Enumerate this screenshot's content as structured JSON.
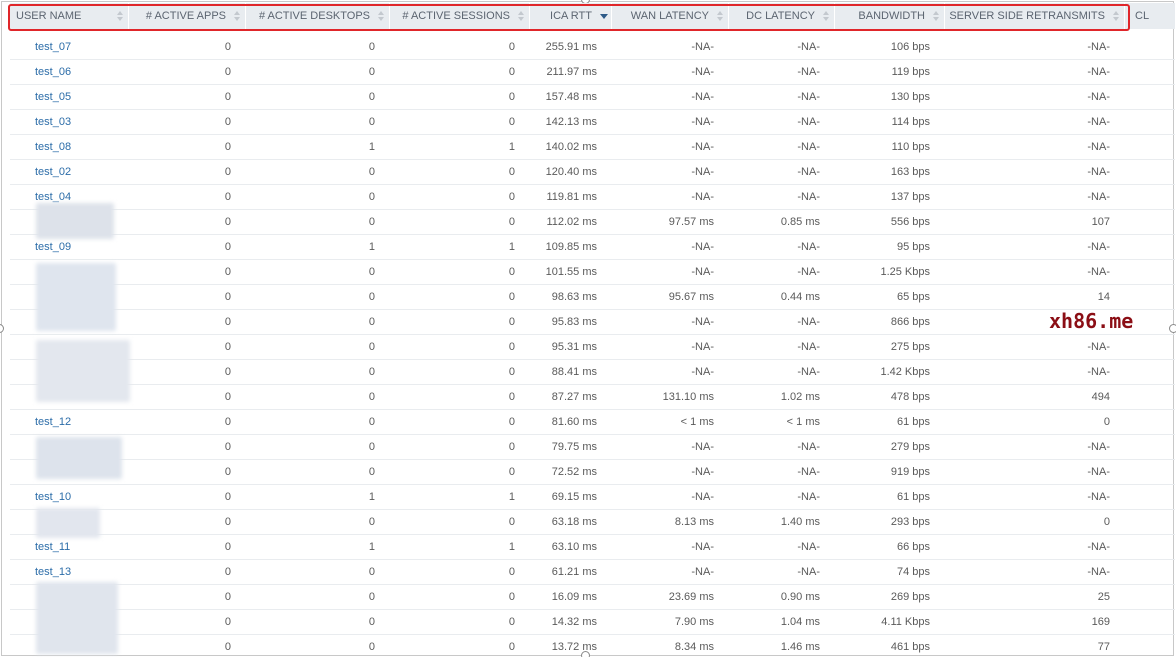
{
  "table": {
    "columns": [
      {
        "label": "USER NAME",
        "sort": "none"
      },
      {
        "label": "# ACTIVE APPS",
        "sort": "none"
      },
      {
        "label": "# ACTIVE DESKTOPS",
        "sort": "none"
      },
      {
        "label": "# ACTIVE SESSIONS",
        "sort": "none"
      },
      {
        "label": "ICA RTT",
        "sort": "descending"
      },
      {
        "label": "WAN LATENCY",
        "sort": "none"
      },
      {
        "label": "DC LATENCY",
        "sort": "none"
      },
      {
        "label": "BANDWIDTH",
        "sort": "none"
      },
      {
        "label": "SERVER SIDE RETRANSMITS",
        "sort": "none"
      },
      {
        "label": "CL",
        "sort": "none"
      }
    ],
    "rows": [
      {
        "user": "test_07",
        "apps": "0",
        "desktops": "0",
        "sessions": "0",
        "ica_rtt": "255.91 ms",
        "wan": "-NA-",
        "dc": "-NA-",
        "bandwidth": "106 bps",
        "retrans": "-NA-"
      },
      {
        "user": "test_06",
        "apps": "0",
        "desktops": "0",
        "sessions": "0",
        "ica_rtt": "211.97 ms",
        "wan": "-NA-",
        "dc": "-NA-",
        "bandwidth": "119 bps",
        "retrans": "-NA-"
      },
      {
        "user": "test_05",
        "apps": "0",
        "desktops": "0",
        "sessions": "0",
        "ica_rtt": "157.48 ms",
        "wan": "-NA-",
        "dc": "-NA-",
        "bandwidth": "130 bps",
        "retrans": "-NA-"
      },
      {
        "user": "test_03",
        "apps": "0",
        "desktops": "0",
        "sessions": "0",
        "ica_rtt": "142.13 ms",
        "wan": "-NA-",
        "dc": "-NA-",
        "bandwidth": "114 bps",
        "retrans": "-NA-"
      },
      {
        "user": "test_08",
        "apps": "0",
        "desktops": "1",
        "sessions": "1",
        "ica_rtt": "140.02 ms",
        "wan": "-NA-",
        "dc": "-NA-",
        "bandwidth": "110 bps",
        "retrans": "-NA-"
      },
      {
        "user": "test_02",
        "apps": "0",
        "desktops": "0",
        "sessions": "0",
        "ica_rtt": "120.40 ms",
        "wan": "-NA-",
        "dc": "-NA-",
        "bandwidth": "163 bps",
        "retrans": "-NA-"
      },
      {
        "user": "test_04",
        "apps": "0",
        "desktops": "0",
        "sessions": "0",
        "ica_rtt": "119.81 ms",
        "wan": "-NA-",
        "dc": "-NA-",
        "bandwidth": "137 bps",
        "retrans": "-NA-"
      },
      {
        "user": "",
        "apps": "0",
        "desktops": "0",
        "sessions": "0",
        "ica_rtt": "112.02 ms",
        "wan": "97.57 ms",
        "dc": "0.85 ms",
        "bandwidth": "556 bps",
        "retrans": "107"
      },
      {
        "user": "test_09",
        "apps": "0",
        "desktops": "1",
        "sessions": "1",
        "ica_rtt": "109.85 ms",
        "wan": "-NA-",
        "dc": "-NA-",
        "bandwidth": "95 bps",
        "retrans": "-NA-"
      },
      {
        "user": "",
        "apps": "0",
        "desktops": "0",
        "sessions": "0",
        "ica_rtt": "101.55 ms",
        "wan": "-NA-",
        "dc": "-NA-",
        "bandwidth": "1.25 Kbps",
        "retrans": "-NA-"
      },
      {
        "user": "",
        "apps": "0",
        "desktops": "0",
        "sessions": "0",
        "ica_rtt": "98.63 ms",
        "wan": "95.67 ms",
        "dc": "0.44 ms",
        "bandwidth": "65 bps",
        "retrans": "14"
      },
      {
        "user": "",
        "apps": "0",
        "desktops": "0",
        "sessions": "0",
        "ica_rtt": "95.83 ms",
        "wan": "-NA-",
        "dc": "-NA-",
        "bandwidth": "866 bps",
        "retrans": ""
      },
      {
        "user": "",
        "apps": "0",
        "desktops": "0",
        "sessions": "0",
        "ica_rtt": "95.31 ms",
        "wan": "-NA-",
        "dc": "-NA-",
        "bandwidth": "275 bps",
        "retrans": "-NA-"
      },
      {
        "user": "",
        "apps": "0",
        "desktops": "0",
        "sessions": "0",
        "ica_rtt": "88.41 ms",
        "wan": "-NA-",
        "dc": "-NA-",
        "bandwidth": "1.42 Kbps",
        "retrans": "-NA-"
      },
      {
        "user": "",
        "apps": "0",
        "desktops": "0",
        "sessions": "0",
        "ica_rtt": "87.27 ms",
        "wan": "131.10 ms",
        "dc": "1.02 ms",
        "bandwidth": "478 bps",
        "retrans": "494"
      },
      {
        "user": "test_12",
        "apps": "0",
        "desktops": "0",
        "sessions": "0",
        "ica_rtt": "81.60 ms",
        "wan": "< 1 ms",
        "dc": "< 1 ms",
        "bandwidth": "61 bps",
        "retrans": "0"
      },
      {
        "user": "",
        "apps": "0",
        "desktops": "0",
        "sessions": "0",
        "ica_rtt": "79.75 ms",
        "wan": "-NA-",
        "dc": "-NA-",
        "bandwidth": "279 bps",
        "retrans": "-NA-"
      },
      {
        "user": "",
        "apps": "0",
        "desktops": "0",
        "sessions": "0",
        "ica_rtt": "72.52 ms",
        "wan": "-NA-",
        "dc": "-NA-",
        "bandwidth": "919 bps",
        "retrans": "-NA-"
      },
      {
        "user": "test_10",
        "apps": "0",
        "desktops": "1",
        "sessions": "1",
        "ica_rtt": "69.15 ms",
        "wan": "-NA-",
        "dc": "-NA-",
        "bandwidth": "61 bps",
        "retrans": "-NA-"
      },
      {
        "user": "",
        "apps": "0",
        "desktops": "0",
        "sessions": "0",
        "ica_rtt": "63.18 ms",
        "wan": "8.13 ms",
        "dc": "1.40 ms",
        "bandwidth": "293 bps",
        "retrans": "0"
      },
      {
        "user": "test_11",
        "apps": "0",
        "desktops": "1",
        "sessions": "1",
        "ica_rtt": "63.10 ms",
        "wan": "-NA-",
        "dc": "-NA-",
        "bandwidth": "66 bps",
        "retrans": "-NA-"
      },
      {
        "user": "test_13",
        "apps": "0",
        "desktops": "0",
        "sessions": "0",
        "ica_rtt": "61.21 ms",
        "wan": "-NA-",
        "dc": "-NA-",
        "bandwidth": "74 bps",
        "retrans": "-NA-"
      },
      {
        "user": "",
        "apps": "0",
        "desktops": "0",
        "sessions": "0",
        "ica_rtt": "16.09 ms",
        "wan": "23.69 ms",
        "dc": "0.90 ms",
        "bandwidth": "269 bps",
        "retrans": "25"
      },
      {
        "user": "",
        "apps": "0",
        "desktops": "0",
        "sessions": "0",
        "ica_rtt": "14.32 ms",
        "wan": "7.90 ms",
        "dc": "1.04 ms",
        "bandwidth": "4.11 Kbps",
        "retrans": "169"
      },
      {
        "user": "",
        "apps": "0",
        "desktops": "0",
        "sessions": "0",
        "ica_rtt": "13.72 ms",
        "wan": "8.34 ms",
        "dc": "1.46 ms",
        "bandwidth": "461 bps",
        "retrans": "77"
      }
    ]
  },
  "watermark": "xh86.me",
  "colors": {
    "link": "#2b6ca8",
    "highlight": "#e0262a",
    "header_bg": "#e8ecf0",
    "watermark": "#8b0e15"
  }
}
